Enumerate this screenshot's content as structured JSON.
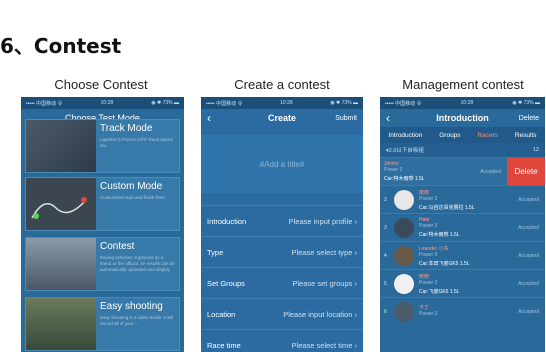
{
  "section": {
    "title": "6、Contest"
  },
  "columns": [
    {
      "title": "Choose Contest"
    },
    {
      "title": "Create a contest"
    },
    {
      "title": "Management contest"
    }
  ],
  "status_bar": {
    "carrier": "••••• 中国移动 令",
    "time": "10:28",
    "battery": "◉ ✱ 73% ▬"
  },
  "choose": {
    "nav_title": "Choose Test Mode",
    "modes": [
      {
        "name": "Track Mode",
        "desc": "Laptime,G-Forces,GPS Track,speed etc."
      },
      {
        "name": "Custom Mode",
        "desc": "Customized start and finish lines."
      },
      {
        "name": "Contest",
        "desc": "Racing activities organized by a friend or the official, he results can be automatically uploaded and display"
      },
      {
        "name": "Easy shooting",
        "desc": "Easy shooting is a video mode, it will record all of your ..."
      }
    ]
  },
  "create": {
    "nav_title": "Create",
    "submit": "Submit",
    "title_placeholder": "#Add a title#",
    "rows": [
      {
        "label": "Introduction",
        "value": "Please input profile"
      },
      {
        "label": "Type",
        "value": "Please select type"
      },
      {
        "label": "Set Groups",
        "value": "Please set groups"
      },
      {
        "label": "Location",
        "value": "Please input location"
      },
      {
        "label": "Race time",
        "value": "Please select time"
      }
    ]
  },
  "manage": {
    "nav_title": "Introduction",
    "delete_nav": "Delete",
    "tabs": [
      "Introduction",
      "Groups",
      "Racers",
      "Results"
    ],
    "active_tab": "Racers",
    "group": {
      "name": "▾2.0以下自吸组",
      "count": "12"
    },
    "racers": [
      {
        "idx": "",
        "name": "Jimmy",
        "sub": "Power 3",
        "car": "Car:特木雨燕 1.5L",
        "status": "Accepted",
        "delete": "Delete"
      },
      {
        "idx": "2",
        "name": "晓晓",
        "sub": "Power 3",
        "car": "Car:马自达昂克赛拉 1.5L",
        "status": "Accepted"
      },
      {
        "idx": "3",
        "name": "Hate",
        "sub": "Power 3",
        "car": "Car:特木雨燕 1.5L",
        "status": "Accepted"
      },
      {
        "idx": "4",
        "name": "Leander 小东",
        "sub": "Power 3",
        "car": "Car:本田飞度GK5 1.5L",
        "status": "Accepted"
      },
      {
        "idx": "5",
        "name": "晓晓",
        "sub": "Power 3",
        "car": "Car:飞度GK5 1.5L",
        "status": "Accepted"
      },
      {
        "idx": "6",
        "name": "卡丁",
        "sub": "Power 3",
        "car": "",
        "status": "Accepted"
      }
    ]
  }
}
